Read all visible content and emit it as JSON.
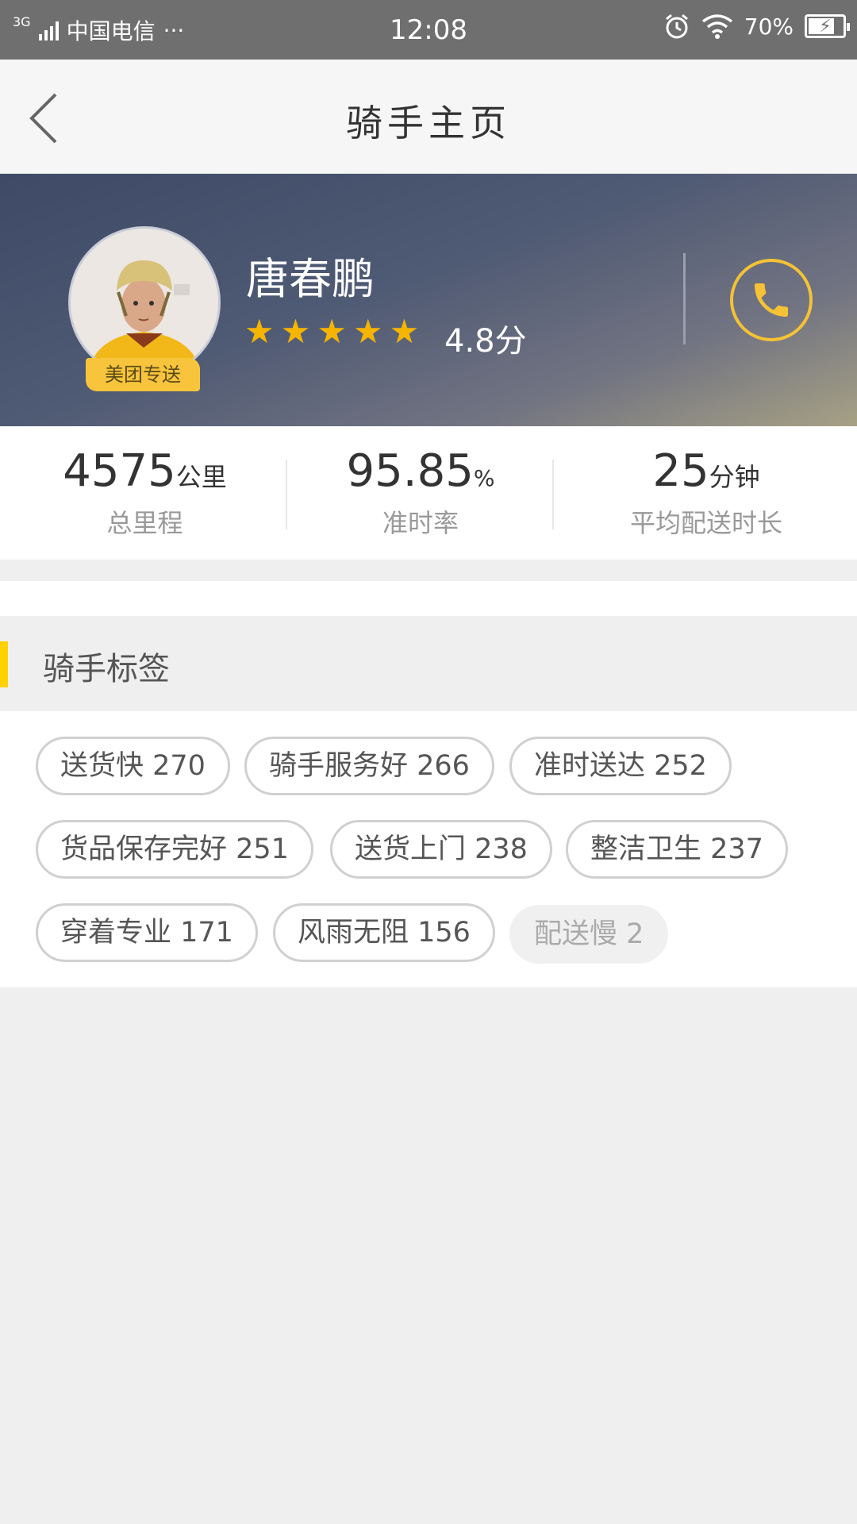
{
  "status_bar": {
    "network": "3G",
    "carrier": "中国电信",
    "more": "···",
    "time": "12:08",
    "battery": "70%"
  },
  "nav": {
    "title": "骑手主页"
  },
  "rider": {
    "name": "唐春鹏",
    "badge": "美团专送",
    "rating": "4.8分",
    "stars": 5
  },
  "stats": [
    {
      "value": "4575",
      "unit": "公里",
      "label": "总里程"
    },
    {
      "value": "95.85",
      "unit": "%",
      "label": "准时率"
    },
    {
      "value": "25",
      "unit": "分钟",
      "label": "平均配送时长"
    }
  ],
  "section": {
    "title": "骑手标签"
  },
  "tags": [
    {
      "text": "送货快 270"
    },
    {
      "text": "骑手服务好 266"
    },
    {
      "text": "准时送达 252"
    },
    {
      "text": "货品保存完好 251"
    },
    {
      "text": "送货上门 238"
    },
    {
      "text": "整洁卫生 237"
    },
    {
      "text": "穿着专业 171"
    },
    {
      "text": "风雨无阻 156"
    },
    {
      "text": "配送慢 2"
    }
  ],
  "colors": {
    "accent": "#ffd100",
    "star": "#f5b400",
    "call_ring": "#f5c235"
  }
}
